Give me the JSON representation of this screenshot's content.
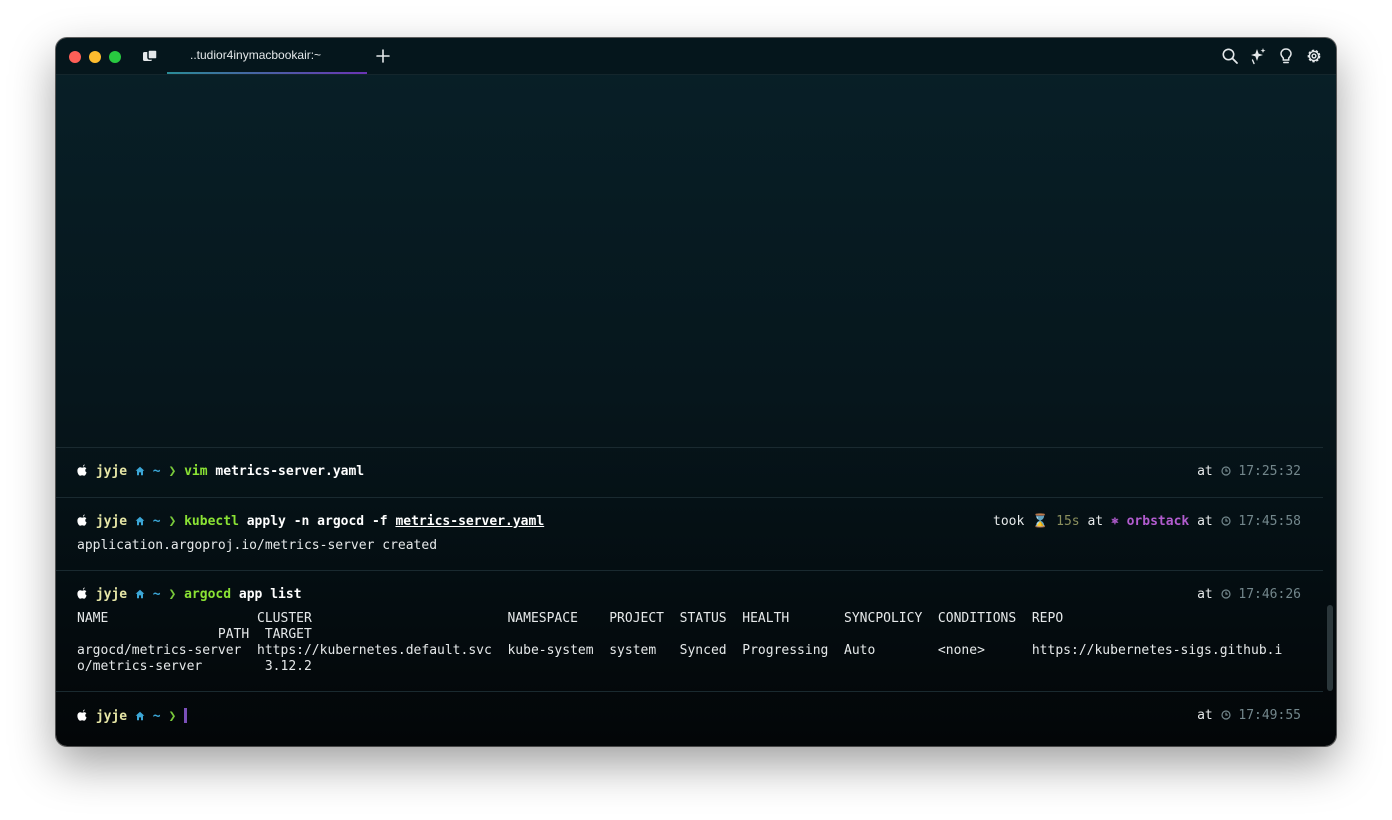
{
  "window": {
    "tab_title": "..tudior4inymacbookair:~",
    "icons": [
      "tabs-overview-icon",
      "new-tab-plus-icon",
      "search-icon",
      "ai-sparkle-icon",
      "lightbulb-icon",
      "gear-icon"
    ]
  },
  "colors": {
    "background": "#06161c",
    "user": "#e6e6a6",
    "path": "#3ba6d6",
    "command": "#8ae234",
    "context": "#b25ccf",
    "cursor": "#7a4fb8"
  },
  "prompt": {
    "user": "jyje",
    "path": "~",
    "chevron": "❯"
  },
  "blocks": [
    {
      "command": "vim",
      "args": [
        {
          "text": "metrics-server.yaml",
          "underline": false
        }
      ],
      "right": {
        "at": "at",
        "time": "17:25:32"
      },
      "output": []
    },
    {
      "command": "kubectl",
      "args": [
        {
          "text": "apply -n argocd -f",
          "underline": false
        },
        {
          "text": "metrics-server.yaml",
          "underline": true
        }
      ],
      "right": {
        "took": "took",
        "duration": "15s",
        "at1": "at",
        "context": "orbstack",
        "at2": "at",
        "time": "17:45:58"
      },
      "output": [
        "application.argoproj.io/metrics-server created"
      ]
    },
    {
      "command": "argocd",
      "args": [
        {
          "text": "app list",
          "underline": false
        }
      ],
      "right": {
        "at": "at",
        "time": "17:46:26"
      },
      "output": [
        "NAME                   CLUSTER                         NAMESPACE    PROJECT  STATUS  HEALTH       SYNCPOLICY  CONDITIONS  REPO",
        "                  PATH  TARGET",
        "argocd/metrics-server  https://kubernetes.default.svc  kube-system  system   Synced  Progressing  Auto        <none>      https://kubernetes-sigs.github.i",
        "o/metrics-server        3.12.2"
      ]
    },
    {
      "command": "",
      "args": [],
      "right": {
        "at": "at",
        "time": "17:49:55"
      },
      "output": []
    }
  ]
}
